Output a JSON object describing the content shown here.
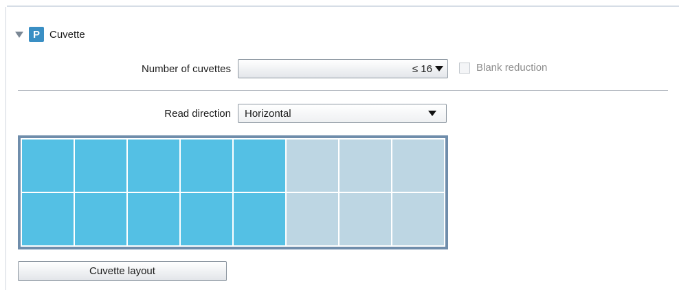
{
  "section": {
    "badge": "P",
    "title": "Cuvette"
  },
  "number_of_cuvettes": {
    "label": "Number of cuvettes",
    "value": "≤ 16"
  },
  "blank_reduction": {
    "label": "Blank reduction",
    "checked": false,
    "enabled": false
  },
  "read_direction": {
    "label": "Read direction",
    "value": "Horizontal"
  },
  "cuvette_grid": {
    "columns": 8,
    "rows": 2,
    "active": [
      [
        true,
        true,
        true,
        true,
        true,
        false,
        false,
        false
      ],
      [
        true,
        true,
        true,
        true,
        true,
        false,
        false,
        false
      ]
    ],
    "colors": {
      "active": "#54c0e4",
      "inactive": "#bdd6e3",
      "frame": "#6f8dab"
    }
  },
  "layout_button": {
    "label": "Cuvette layout"
  },
  "icons": {
    "expander": "triangle-down-icon",
    "dropdown": "dropdown-arrow-icon"
  },
  "colors": {
    "badge": "#3a8fc4"
  }
}
